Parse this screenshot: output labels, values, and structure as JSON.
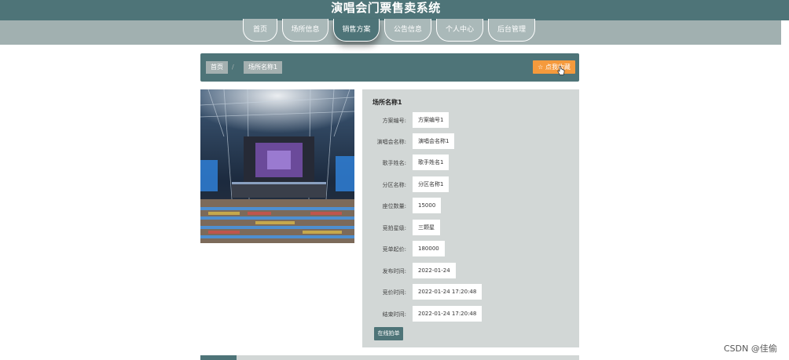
{
  "header": {
    "title": "演唱会门票售卖系统"
  },
  "nav": {
    "items": [
      {
        "label": "首页",
        "active": false
      },
      {
        "label": "场所信息",
        "active": false
      },
      {
        "label": "销售方案",
        "active": true
      },
      {
        "label": "公告信息",
        "active": false
      },
      {
        "label": "个人中心",
        "active": false
      },
      {
        "label": "后台管理",
        "active": false
      }
    ]
  },
  "breadcrumb": {
    "home": "首页",
    "separator": "/",
    "current": "场所名称1"
  },
  "favorite": {
    "label": "☆ 点我收藏"
  },
  "detail": {
    "title": "场所名称1",
    "fields": [
      {
        "label": "方案编号:",
        "value": "方案编号1"
      },
      {
        "label": "演唱会名称:",
        "value": "演唱会名称1"
      },
      {
        "label": "歌手姓名:",
        "value": "歌手姓名1"
      },
      {
        "label": "分区名称:",
        "value": "分区名称1"
      },
      {
        "label": "座位数量:",
        "value": "15000"
      },
      {
        "label": "竞拍星级:",
        "value": "三颗星"
      },
      {
        "label": "竞单起价:",
        "value": "180000"
      },
      {
        "label": "发布时间:",
        "value": "2022-01-24"
      },
      {
        "label": "竞价时间:",
        "value": "2022-01-24 17:20:48"
      },
      {
        "label": "结束时间:",
        "value": "2022-01-24 17:20:48"
      }
    ],
    "bid_button": "在线拍单"
  },
  "watermark": "CSDN @佳偷",
  "colors": {
    "primary": "#4e7478",
    "nav_bg": "#a1b0b0",
    "accent": "#f59a3c",
    "panel_bg": "#d2d7d6"
  }
}
